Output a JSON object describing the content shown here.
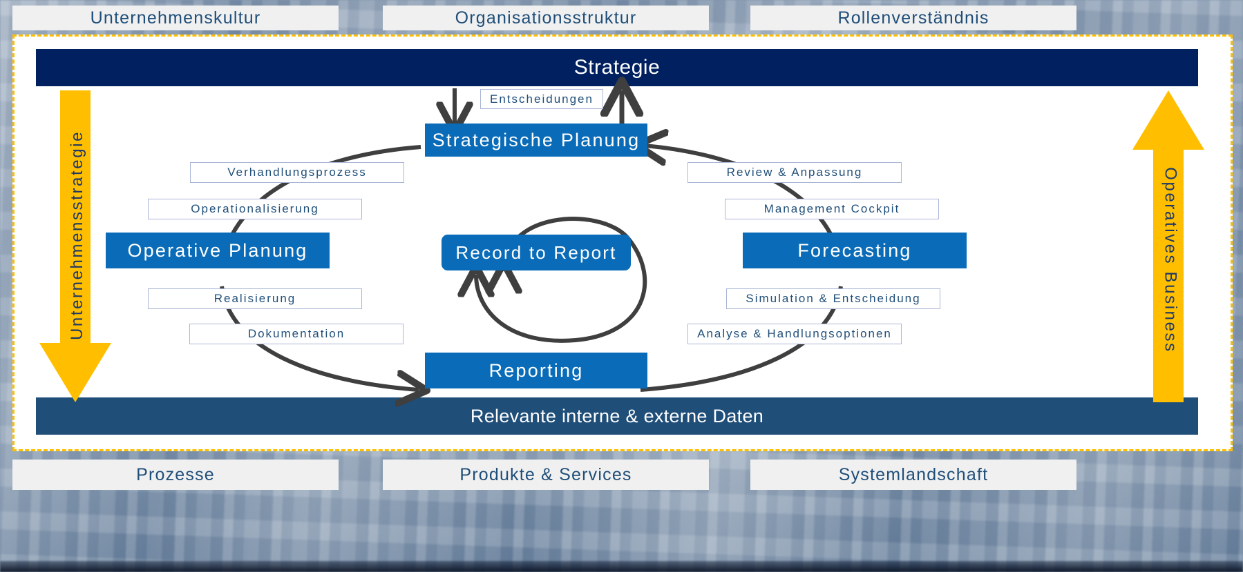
{
  "colors": {
    "navy_dark": "#002060",
    "navy_mid": "#1f4e79",
    "process_blue": "#0a6cb8",
    "accent_yellow": "#ffbf00",
    "caption_border": "#aab6d6",
    "caption_text": "#1f4e79",
    "connector_gray": "#3f3f3f",
    "panel_bg": "#f0f0f0"
  },
  "top_bars": [
    {
      "label": "Unternehmenskultur"
    },
    {
      "label": "Organisationsstruktur"
    },
    {
      "label": "Rollenverständnis"
    }
  ],
  "bottom_bars": [
    {
      "label": "Prozesse"
    },
    {
      "label": "Produkte & Services"
    },
    {
      "label": "Systemlandschaft"
    }
  ],
  "header_bar": {
    "label": "Strategie"
  },
  "footer_bar": {
    "label": "Relevante interne & externe Daten"
  },
  "side_arrows": {
    "left": {
      "label": "Unternehmensstrategie",
      "direction": "down"
    },
    "right": {
      "label": "Operatives Business",
      "direction": "up"
    }
  },
  "process_boxes": [
    {
      "id": "strategische-planung",
      "label": "Strategische  Planung"
    },
    {
      "id": "operative-planung",
      "label": "Operative Planung"
    },
    {
      "id": "record-to-report",
      "label": "Record to Report"
    },
    {
      "id": "forecasting",
      "label": "Forecasting"
    },
    {
      "id": "reporting",
      "label": "Reporting"
    }
  ],
  "captions": {
    "entscheidungen": "Entscheidungen",
    "left": [
      "Verhandlungsprozess",
      "Operationalisierung",
      "Realisierung",
      "Dokumentation"
    ],
    "right": [
      "Review & Anpassung",
      "Management Cockpit",
      "Simulation & Entscheidung",
      "Analyse & Handlungsoptionen"
    ]
  }
}
